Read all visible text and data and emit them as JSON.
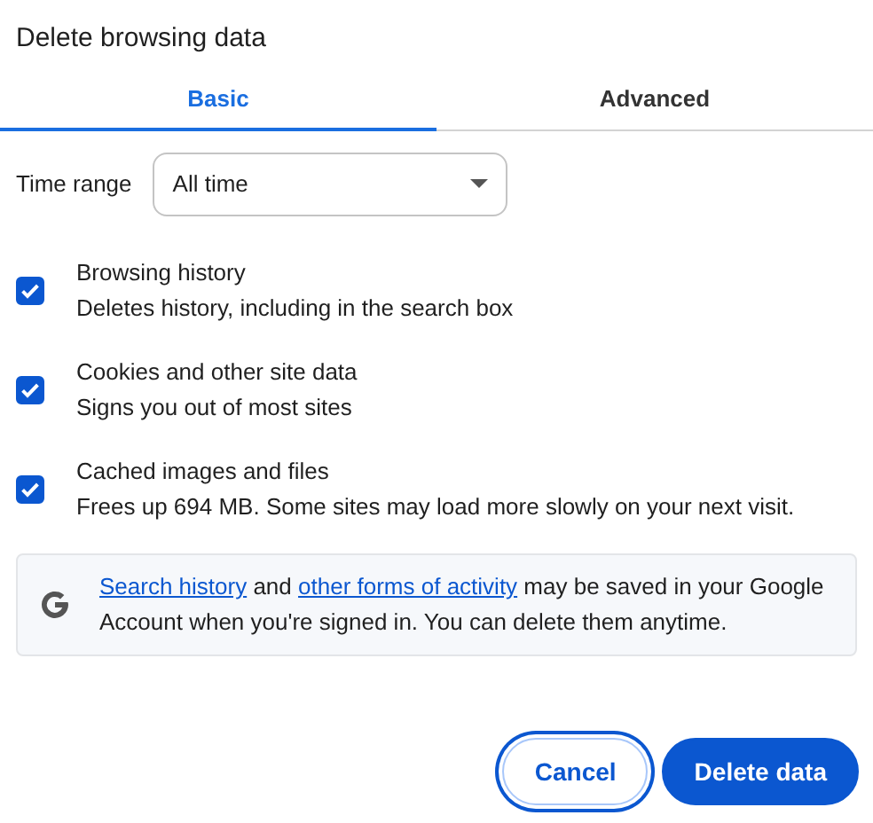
{
  "title": "Delete browsing data",
  "tabs": [
    {
      "label": "Basic",
      "selected": true
    },
    {
      "label": "Advanced",
      "selected": false
    }
  ],
  "time_range": {
    "label": "Time range",
    "value": "All time"
  },
  "options": [
    {
      "title": "Browsing history",
      "description": "Deletes history, including in the search box",
      "checked": true
    },
    {
      "title": "Cookies and other site data",
      "description": "Signs you out of most sites",
      "checked": true
    },
    {
      "title": "Cached images and files",
      "description": "Frees up 694 MB. Some sites may load more slowly on your next visit.",
      "checked": true
    }
  ],
  "info": [
    {
      "kind": "link",
      "text": "Search history"
    },
    {
      "kind": "text",
      "text": " and "
    },
    {
      "kind": "link",
      "text": "other forms of activity"
    },
    {
      "kind": "text",
      "text": " may be saved in your Google Account when you're signed in. You can delete them anytime."
    }
  ],
  "buttons": [
    {
      "label": "Cancel",
      "kind": "secondary",
      "focused": true
    },
    {
      "label": "Delete data",
      "kind": "primary",
      "focused": false
    }
  ]
}
